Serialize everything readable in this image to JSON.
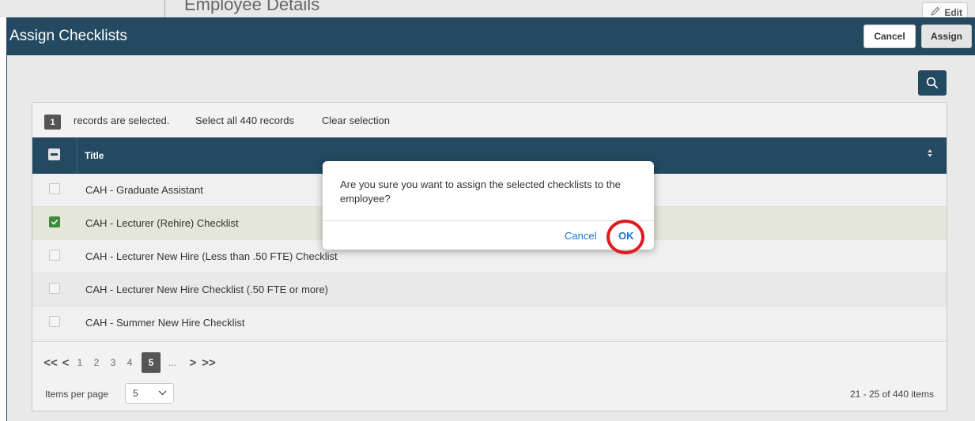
{
  "background": {
    "page_title": "Employee Details",
    "edit_label": "Edit"
  },
  "modal": {
    "title": "Assign Checklists",
    "cancel_label": "Cancel",
    "assign_label": "Assign",
    "search_icon": "search-icon"
  },
  "selection": {
    "count": "1",
    "text": "records are selected.",
    "select_all": "Select all 440 records",
    "clear": "Clear selection"
  },
  "table": {
    "header_title": "Title",
    "rows": [
      {
        "title": "CAH - Graduate Assistant",
        "checked": false
      },
      {
        "title": "CAH - Lecturer (Rehire) Checklist",
        "checked": true
      },
      {
        "title": "CAH - Lecturer New Hire (Less than .50 FTE) Checklist",
        "checked": false
      },
      {
        "title": "CAH - Lecturer New Hire Checklist (.50 FTE or more)",
        "checked": false
      },
      {
        "title": "CAH - Summer New Hire Checklist",
        "checked": false
      }
    ]
  },
  "pager": {
    "first": "<<",
    "prev": "<",
    "pages": [
      "1",
      "2",
      "3",
      "4",
      "5"
    ],
    "ellipsis": "...",
    "next": ">",
    "last": ">>",
    "current_page": "5",
    "items_per_page_label": "Items per page",
    "items_per_page_value": "5",
    "range_text": "21 - 25 of 440 items"
  },
  "dialog": {
    "message": "Are you sure you want to assign the selected checklists to the employee?",
    "cancel_label": "Cancel",
    "ok_label": "OK"
  },
  "colors": {
    "header_bg": "#234a61",
    "link_blue": "#1b74d0",
    "highlight_red": "#e01b1b",
    "checkbox_green": "#3f8a3a"
  }
}
